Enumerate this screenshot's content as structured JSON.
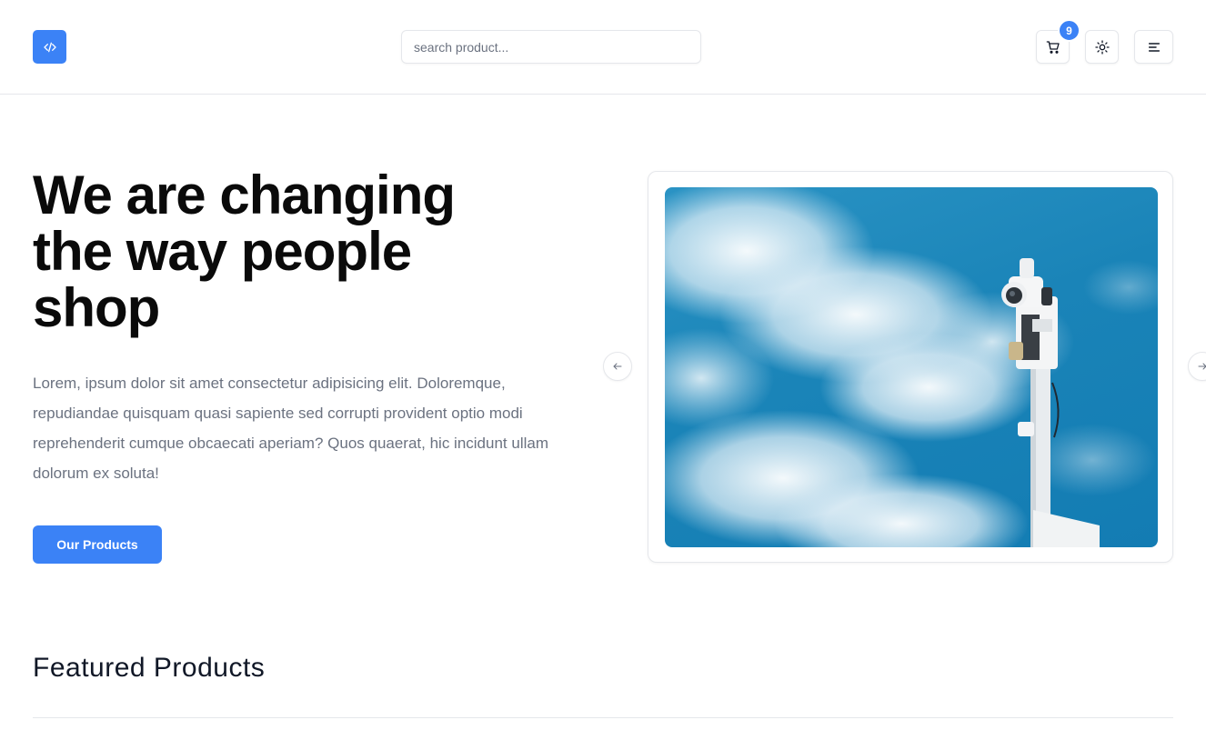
{
  "header": {
    "search_placeholder": "search product...",
    "cart_count": "9",
    "logo_icon": "code-icon",
    "cart_icon": "cart-icon",
    "theme_icon": "sun-icon",
    "menu_icon": "menu-icon"
  },
  "hero": {
    "title": "We are changing the way people shop",
    "description": "Lorem, ipsum dolor sit amet consectetur adipisicing elit. Doloremque, repudiandae quisquam quasi sapiente sed corrupti provident optio modi reprehenderit cumque obcaecati aperiam? Quos quaerat, hic incidunt ullam dolorum ex soluta!",
    "cta_label": "Our Products"
  },
  "carousel": {
    "prev_icon": "arrow-left-icon",
    "next_icon": "arrow-right-icon",
    "image": "security-camera-pole-sky"
  },
  "featured": {
    "title": "Featured Products"
  },
  "colors": {
    "accent": "#3b82f6",
    "sky": "#1a84b8"
  }
}
